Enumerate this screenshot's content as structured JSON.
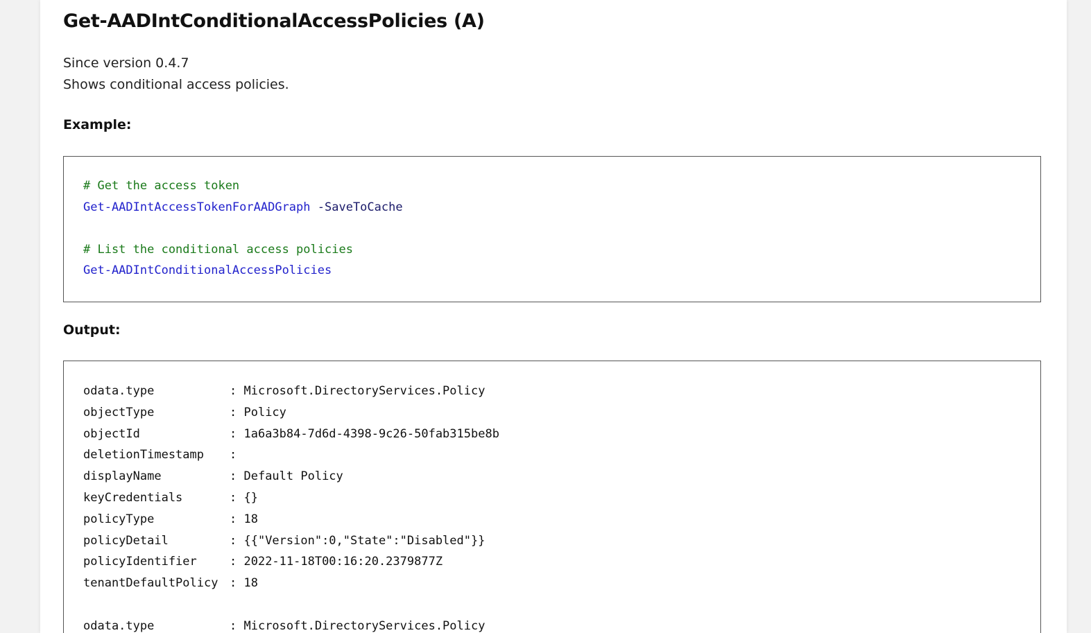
{
  "title": "Get-AADIntConditionalAccessPolicies (A)",
  "since": "Since version 0.4.7",
  "description": "Shows conditional access policies.",
  "example_label": "Example:",
  "output_label": "Output:",
  "example": {
    "comment1": "# Get the access token",
    "cmd1": "Get-AADIntAccessTokenForAADGraph",
    "param1": "-SaveToCache",
    "comment2": "# List the conditional access policies",
    "cmd2": "Get-AADIntConditionalAccessPolicies"
  },
  "output": {
    "records": [
      [
        {
          "key": "odata.type",
          "value": "Microsoft.DirectoryServices.Policy"
        },
        {
          "key": "objectType",
          "value": "Policy"
        },
        {
          "key": "objectId",
          "value": "1a6a3b84-7d6d-4398-9c26-50fab315be8b"
        },
        {
          "key": "deletionTimestamp",
          "value": ""
        },
        {
          "key": "displayName",
          "value": "Default Policy"
        },
        {
          "key": "keyCredentials",
          "value": "{}"
        },
        {
          "key": "policyType",
          "value": "18"
        },
        {
          "key": "policyDetail",
          "value": "{{\"Version\":0,\"State\":\"Disabled\"}}"
        },
        {
          "key": "policyIdentifier",
          "value": "2022-11-18T00:16:20.2379877Z"
        },
        {
          "key": "tenantDefaultPolicy",
          "value": "18"
        }
      ],
      [
        {
          "key": "odata.type",
          "value": "Microsoft.DirectoryServices.Policy"
        }
      ]
    ]
  }
}
